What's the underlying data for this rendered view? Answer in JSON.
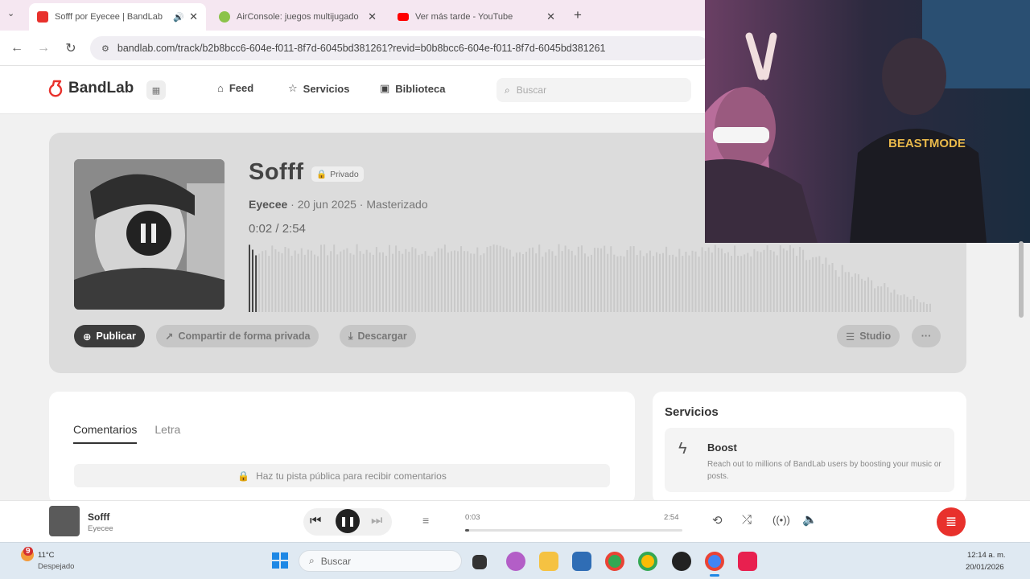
{
  "browser": {
    "tabs": [
      {
        "title": "Sofff por Eyecee | BandLab"
      },
      {
        "title": "AirConsole: juegos multijugado"
      },
      {
        "title": "Ver más tarde - YouTube"
      }
    ],
    "new_tab": "+",
    "url": "bandlab.com/track/b2b8bcc6-604e-f011-8f7d-6045bd381261?revid=b0b8bcc6-604e-f011-8f7d-6045bd381261"
  },
  "site": {
    "logo": "BandLab",
    "nav": [
      {
        "label": "Feed"
      },
      {
        "label": "Servicios"
      },
      {
        "label": "Biblioteca"
      }
    ],
    "search_placeholder": "Buscar"
  },
  "track": {
    "title": "Sofff",
    "privacy": "Privado",
    "artist": "Eyecee",
    "meta_rest": "· 20 jun 2025 · Masterizado",
    "time": "0:02 / 2:54",
    "progress": 0.011
  },
  "actions": {
    "publish": "Publicar",
    "share_private": "Compartir de forma privada",
    "download": "Descargar",
    "studio": "Studio",
    "more": "···"
  },
  "comments": {
    "tabs": [
      "Comentarios",
      "Letra"
    ],
    "note": "Haz tu pista pública para recibir comentarios"
  },
  "services": {
    "heading": "Servicios",
    "boost_title": "Boost",
    "boost_desc": "Reach out to millions of BandLab users by boosting your music or posts."
  },
  "player": {
    "title": "Sofff",
    "artist": "Eyecee",
    "elapsed": "0:03",
    "duration": "2:54",
    "progress": 0.017
  },
  "taskbar": {
    "temperature": "11°C",
    "weather": "Despejado",
    "search_placeholder": "Buscar",
    "time": "12:14 a. m.",
    "date": "20/01/2026",
    "weather_badge": "9"
  },
  "colors": {
    "accent": "#e8312c",
    "card": "#dcdcdc",
    "dark_pill": "#3c3c3c"
  }
}
